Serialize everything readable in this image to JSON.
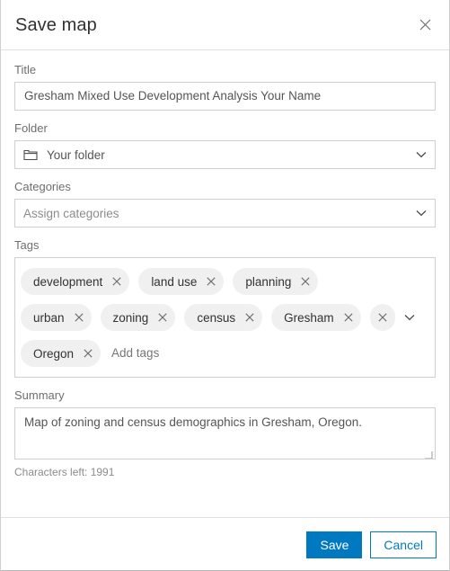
{
  "dialog": {
    "title": "Save map",
    "close_icon": "close-icon"
  },
  "form": {
    "title_field": {
      "label": "Title",
      "value": "Gresham Mixed Use Development Analysis Your Name"
    },
    "folder_field": {
      "label": "Folder",
      "value": "Your folder",
      "icon": "folder-icon",
      "chevron": "chevron-down-icon"
    },
    "categories_field": {
      "label": "Categories",
      "placeholder": "Assign categories",
      "value": "",
      "chevron": "chevron-down-icon"
    },
    "tags_field": {
      "label": "Tags",
      "placeholder": "Add tags",
      "chevron": "chevron-down-icon",
      "tags": [
        "development",
        "land use",
        "planning",
        "urban",
        "zoning",
        "census",
        "Gresham",
        "Oregon"
      ],
      "rows": [
        [
          "development",
          "land use",
          "planning"
        ],
        [
          "urban",
          "zoning",
          "census",
          "Gresham"
        ],
        [
          "Oregon"
        ]
      ],
      "clipped_chip_label": ""
    },
    "summary_field": {
      "label": "Summary",
      "value": "Map of zoning and census demographics in Gresham, Oregon.",
      "characters_left": "Characters left: 1991"
    }
  },
  "footer": {
    "save_label": "Save",
    "cancel_label": "Cancel"
  },
  "colors": {
    "accent": "#0079c1",
    "border": "#cfcfcf",
    "chip_bg": "#f0f0f0",
    "label_text": "#6e6e6e",
    "title_text": "#323232"
  }
}
